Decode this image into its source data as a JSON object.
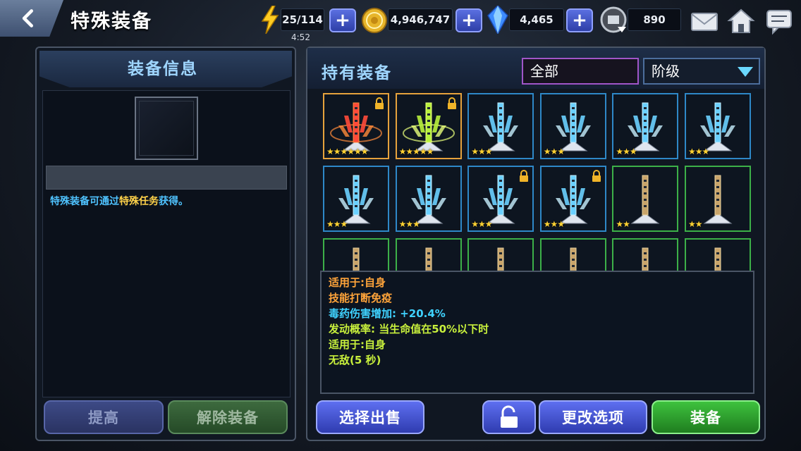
{
  "header": {
    "title": "特殊装备",
    "energy": "25/114",
    "energy_timer": "4:52",
    "gold": "4,946,747",
    "crystals": "4,465",
    "tickets": "890"
  },
  "left": {
    "header": "装备信息",
    "hint_prefix": "特殊装备可通过",
    "hint_highlight": "特殊任务",
    "hint_suffix": "获得。",
    "upgrade_label": "提高",
    "unequip_label": "解除装备"
  },
  "right": {
    "header": "持有装备",
    "filter_all": "全部",
    "filter_sort": "阶级",
    "sell_label": "选择出售",
    "change_label": "更改选项",
    "equip_label": "装备"
  },
  "items": [
    {
      "rarity": "gold",
      "color": "red",
      "stars": "★★★★★★",
      "locked": true
    },
    {
      "rarity": "gold",
      "color": "lime",
      "stars": "★★★★★",
      "locked": true
    },
    {
      "rarity": "blue",
      "color": "blue",
      "stars": "★★★",
      "locked": false
    },
    {
      "rarity": "blue",
      "color": "blue",
      "stars": "★★★",
      "locked": false
    },
    {
      "rarity": "blue",
      "color": "blue",
      "stars": "★★★",
      "locked": false
    },
    {
      "rarity": "blue",
      "color": "blue",
      "stars": "★★★",
      "locked": false
    },
    {
      "rarity": "blue",
      "color": "blue",
      "stars": "★★★",
      "locked": false
    },
    {
      "rarity": "blue",
      "color": "blue",
      "stars": "★★★",
      "locked": false
    },
    {
      "rarity": "blue",
      "color": "blue",
      "stars": "★★★",
      "locked": true
    },
    {
      "rarity": "blue",
      "color": "blue",
      "stars": "★★★",
      "locked": true
    },
    {
      "rarity": "green",
      "color": "bronze",
      "stars": "★★",
      "locked": false
    },
    {
      "rarity": "green",
      "color": "bronze",
      "stars": "★★",
      "locked": false
    },
    {
      "rarity": "green",
      "color": "bronze",
      "stars": "",
      "locked": false
    },
    {
      "rarity": "green",
      "color": "bronze",
      "stars": "",
      "locked": false
    },
    {
      "rarity": "green",
      "color": "bronze",
      "stars": "",
      "locked": false
    },
    {
      "rarity": "green",
      "color": "bronze",
      "stars": "",
      "locked": false
    },
    {
      "rarity": "green",
      "color": "bronze",
      "stars": "",
      "locked": false
    },
    {
      "rarity": "green",
      "color": "bronze",
      "stars": "",
      "locked": false
    }
  ],
  "description": [
    {
      "text": "适用于:自身",
      "color": "orange"
    },
    {
      "text": "技能打断免疫",
      "color": "orange"
    },
    {
      "text": "毒药伤害增加: +20.4%",
      "color": "cyan"
    },
    {
      "text": "发动概率: 当生命值在50%以下时",
      "color": "lime"
    },
    {
      "text": "适用于:自身",
      "color": "lime"
    },
    {
      "text": "无敌(5 秒)",
      "color": "lime"
    }
  ],
  "icons": {
    "back": "chevron-left-icon",
    "energy": "lightning-icon",
    "gold": "gold-coin-icon",
    "crystals": "crystal-icon",
    "tickets": "ticket-icon",
    "mail": "mail-icon",
    "home": "home-icon",
    "chat": "chat-icon",
    "lock": "lock-icon",
    "unlock": "unlock-icon"
  },
  "colors": {
    "gold_frame": "#e6a23c",
    "blue_frame": "#2e88c8",
    "green_frame": "#3cb048",
    "equip_green": "#3ec23e",
    "sell_blue": "#5e6ff0"
  }
}
